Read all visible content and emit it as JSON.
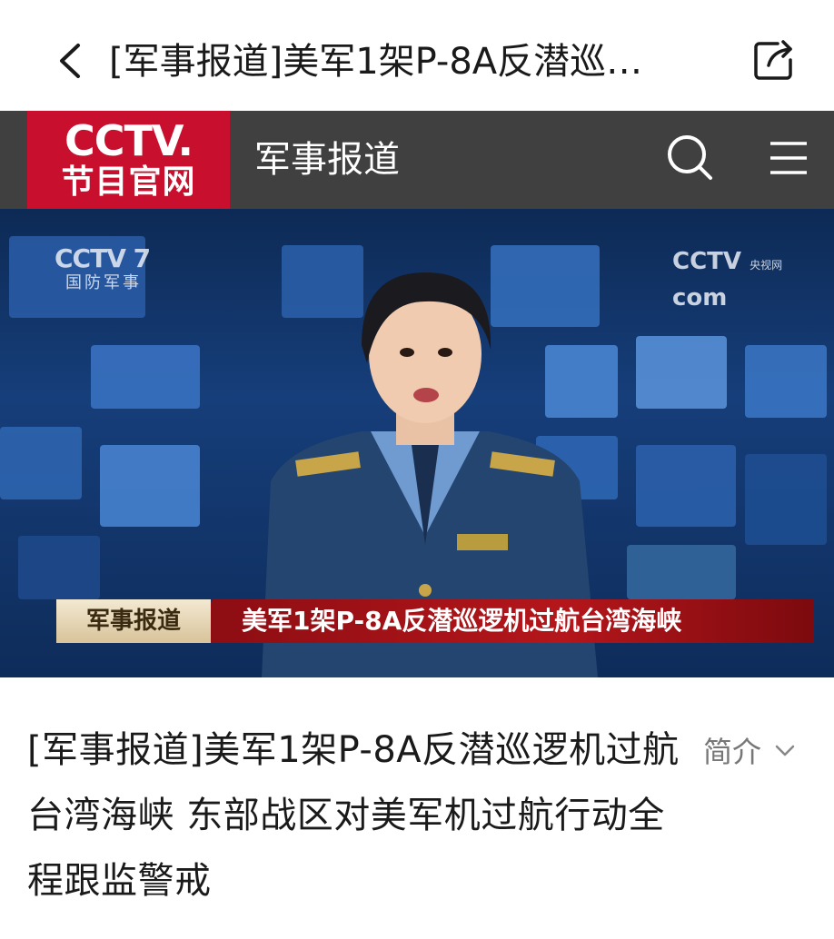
{
  "nav": {
    "title": "[军事报道]美军1架P-8A反潜巡…"
  },
  "channel_header": {
    "logo_top": "CCTV.",
    "logo_bottom": "节目官网",
    "channel_name": "军事报道"
  },
  "video": {
    "watermark_left_logo": "CCTV 7",
    "watermark_left_sub": "国防军事",
    "watermark_right_logo": "CCTV",
    "watermark_right_sub": "央视网",
    "watermark_right_com": "com",
    "lower_third_tag": "军事报道",
    "lower_third_headline": "美军1架P-8A反潜巡逻机过航台湾海峡"
  },
  "description": {
    "text": "[军事报道]美军1架P-8A反潜巡逻机过航台湾海峡 东部战区对美军机过航行动全程跟监警戒",
    "intro_label": "简介"
  },
  "colors": {
    "cctv_red": "#c8102e",
    "header_bg": "#404040",
    "lower_third_red": "#b4161b"
  },
  "icons": [
    "back-arrow-icon",
    "share-icon",
    "search-icon",
    "menu-icon",
    "chevron-down-icon"
  ]
}
